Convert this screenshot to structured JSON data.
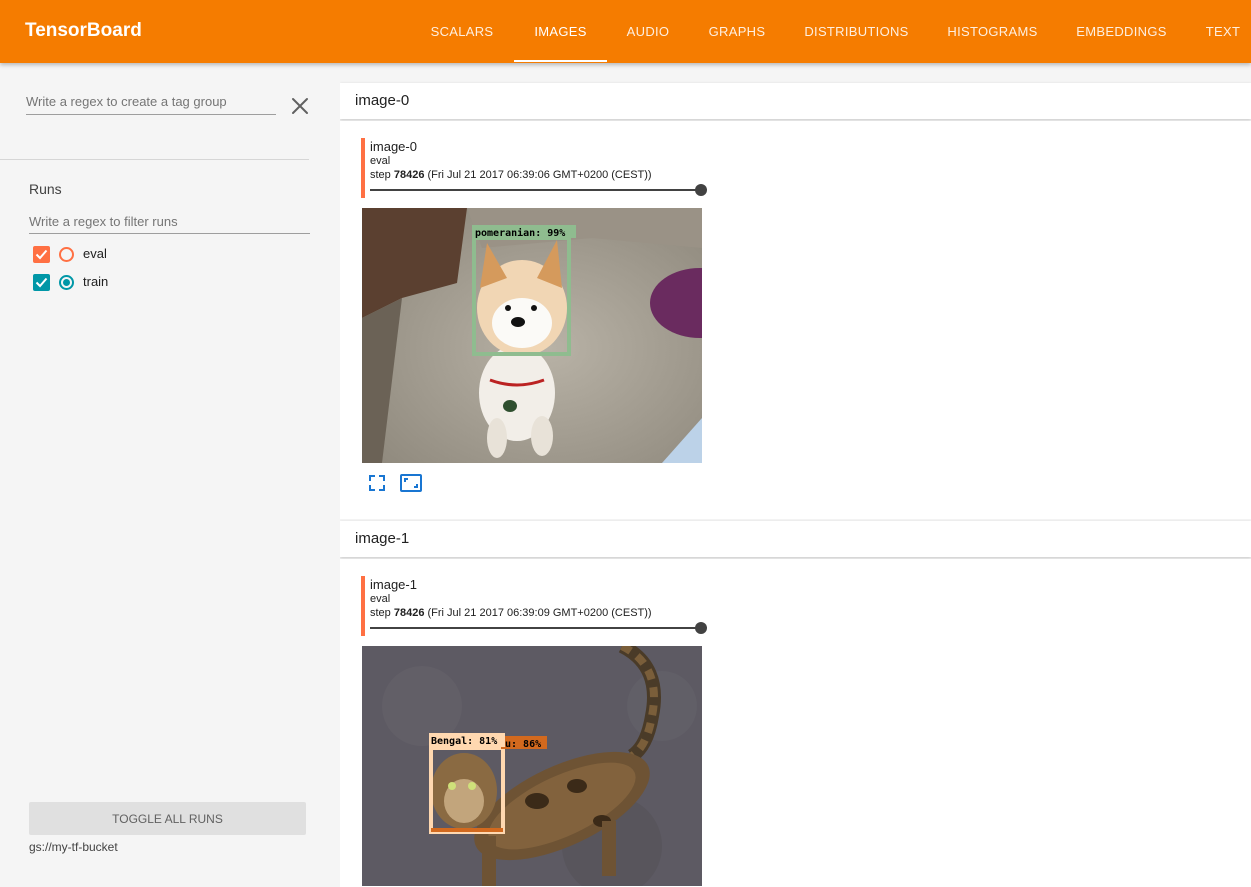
{
  "app": {
    "title": "TensorBoard",
    "accent_color": "#f57c00"
  },
  "tabs": [
    {
      "label": "SCALARS",
      "active": false
    },
    {
      "label": "IMAGES",
      "active": true
    },
    {
      "label": "AUDIO",
      "active": false
    },
    {
      "label": "GRAPHS",
      "active": false
    },
    {
      "label": "DISTRIBUTIONS",
      "active": false
    },
    {
      "label": "HISTOGRAMS",
      "active": false
    },
    {
      "label": "EMBEDDINGS",
      "active": false
    },
    {
      "label": "TEXT",
      "active": false
    }
  ],
  "sidebar": {
    "tag_filter_placeholder": "Write a regex to create a tag group",
    "clear_icon": "close-icon",
    "runs_title": "Runs",
    "runs_filter_placeholder": "Write a regex to filter runs",
    "runs": [
      {
        "name": "eval",
        "checked": true,
        "selected": false,
        "color": "#ff7043"
      },
      {
        "name": "train",
        "checked": true,
        "selected": true,
        "color": "#0097a7"
      }
    ],
    "toggle_all_label": "TOGGLE ALL RUNS",
    "logdir": "gs://my-tf-bucket"
  },
  "categories": [
    {
      "title": "image-0",
      "card": {
        "tag": "image-0",
        "run": "eval",
        "step_prefix": "step ",
        "step": "78426",
        "timestamp": " (Fri Jul 21 2017 06:39:06 GMT+0200 (CEST))",
        "detections": [
          {
            "label": "pomeranian: 99%",
            "color": "#8fbc8f"
          }
        ],
        "icons": [
          "fullscreen-icon",
          "actual-size-icon"
        ]
      }
    },
    {
      "title": "image-1",
      "card": {
        "tag": "image-1",
        "run": "eval",
        "step_prefix": "step ",
        "step": "78426",
        "timestamp": " (Fri Jul 21 2017 06:39:09 GMT+0200 (CEST))",
        "detections": [
          {
            "label": "Bengal: 81%",
            "color": "#ffd8b0"
          },
          {
            "label": "u: 86%",
            "color": "#d2691e"
          }
        ]
      }
    }
  ]
}
